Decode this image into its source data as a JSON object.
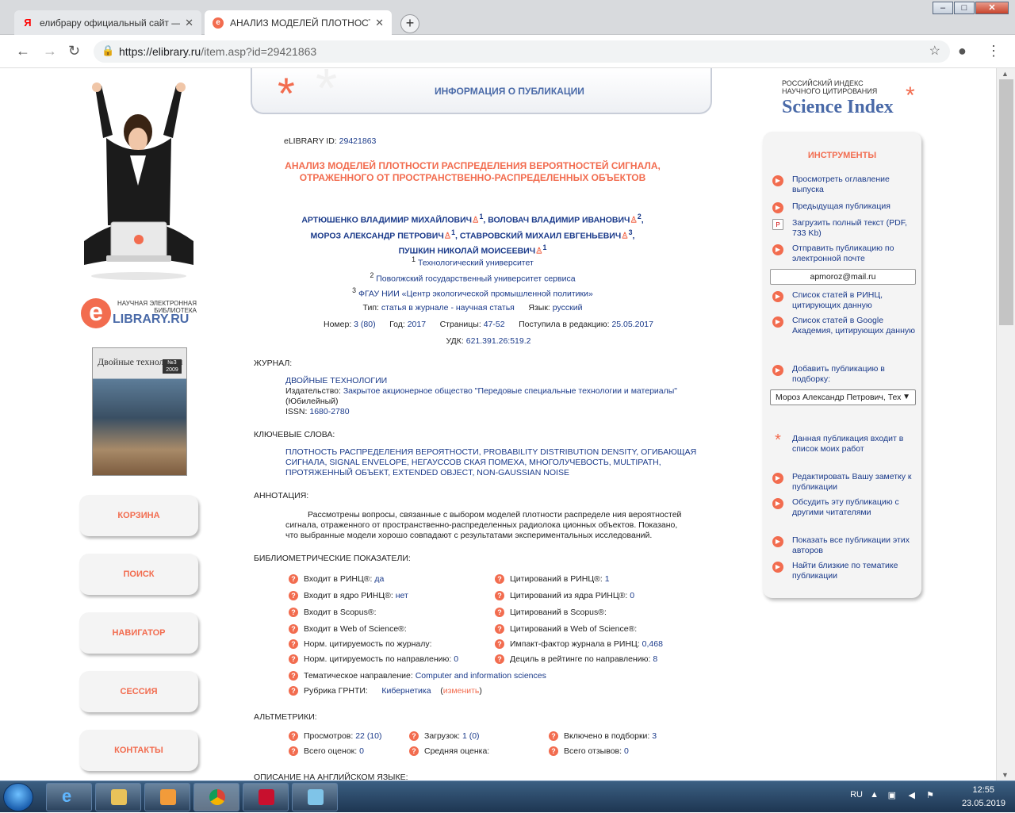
{
  "browser": {
    "tabs": [
      {
        "title": "елибрару официальный сайт — ...",
        "favicon": "yandex-icon",
        "active": false
      },
      {
        "title": "АНАЛИЗ МОДЕЛЕЙ ПЛОТНОСТИ",
        "favicon": "elibrary-icon",
        "active": true
      }
    ],
    "url_host": "https://elibrary.ru",
    "url_path": "/item.asp?id=29421863"
  },
  "left": {
    "logo_line1": "НАУЧНАЯ ЭЛЕКТРОННАЯ",
    "logo_line2": "БИБЛИОТЕКА",
    "logo_main": "LIBRARY.RU",
    "cover_title": "Двойные технологии",
    "cover_issue": "№3 2009",
    "nav": [
      "КОРЗИНА",
      "ПОИСК",
      "НАВИГАТОР",
      "СЕССИЯ",
      "КОНТАКТЫ"
    ]
  },
  "header": {
    "title": "ИНФОРМАЦИЯ О ПУБЛИКАЦИИ"
  },
  "pub": {
    "id_label": "eLIBRARY ID:",
    "id": "29421863",
    "title": "АНАЛИЗ МОДЕЛЕЙ ПЛОТНОСТИ РАСПРЕДЕЛЕНИЯ ВЕРОЯТНОСТЕЙ СИГНАЛА, ОТРАЖЕННОГО ОТ ПРОСТРАНСТВЕННО-РАСПРЕДЕЛЕННЫХ ОБЪЕКТОВ",
    "authors": [
      {
        "name": "АРТЮШЕНКО ВЛАДИМИР МИХАЙЛОВИЧ",
        "sup": "1"
      },
      {
        "name": "ВОЛОВАЧ ВЛАДИМИР ИВАНОВИЧ",
        "sup": "2"
      },
      {
        "name": "МОРОЗ АЛЕКСАНДР ПЕТРОВИЧ",
        "sup": "1"
      },
      {
        "name": "СТАВРОВСКИЙ МИХАИЛ ЕВГЕНЬЕВИЧ",
        "sup": "3"
      },
      {
        "name": "ПУШКИН НИКОЛАЙ МОИСЕЕВИЧ",
        "sup": "1"
      }
    ],
    "affiliations": [
      {
        "n": "1",
        "name": "Технологический университет"
      },
      {
        "n": "2",
        "name": "Поволжский государственный университет сервиса"
      },
      {
        "n": "3",
        "name": "ФГАУ НИИ «Центр экологической промышленной политики»"
      }
    ],
    "type_label": "Тип:",
    "type": "статья в журнале - научная статья",
    "lang_label": "Язык:",
    "lang": "русский",
    "num_label": "Номер:",
    "num": "3 (80)",
    "year_label": "Год:",
    "year": "2017",
    "pages_label": "Страницы:",
    "pages": "47-52",
    "received_label": "Поступила в редакцию:",
    "received": "25.05.2017",
    "udk_label": "УДК:",
    "udk": "621.391.26:519.2"
  },
  "journal": {
    "heading": "ЖУРНАЛ:",
    "name": "ДВОЙНЫЕ ТЕХНОЛОГИИ",
    "publisher_label": "Издательство:",
    "publisher": "Закрытое акционерное общество \"Передовые специальные технологии и материалы\"",
    "jubilee": "(Юбилейный)",
    "issn_label": "ISSN:",
    "issn": "1680-2780"
  },
  "keywords": {
    "heading": "КЛЮЧЕВЫЕ СЛОВА:",
    "line1": "ПЛОТНОСТЬ РАСПРЕДЕЛЕНИЯ ВЕРОЯТНОСТИ, PROBABILITY DISTRIBUTION DENSITY, ОГИБАЮЩАЯ",
    "line2": "СИГНАЛА, SIGNAL ENVELOPE, НЕГАУССОВ СКАЯ ПОМЕХА, МНОГОЛУЧЕВОСТЬ, MULTIPATH,",
    "line3": "ПРОТЯЖЕННЫЙ ОБЪЕКТ, EXTENDED OBJECT, NON-GAUSSIAN NOISE"
  },
  "annotation": {
    "heading": "АННОТАЦИЯ:",
    "line1": "Рассмотрены вопросы, связанные с выбором моделей плотности распределе ния вероятностей",
    "line2": "сигнала, отраженного от пространственно-распределенных радиолока ционных объектов. Показано,",
    "line3": "что выбранные модели хорошо совпадают с результатами экспериментальных исследований."
  },
  "biblio": {
    "heading": "БИБЛИОМЕТРИЧЕСКИЕ ПОКАЗАТЕЛИ:",
    "left": [
      {
        "label": "Входит в РИНЦ®:",
        "value": "да"
      },
      {
        "label": "Входит в ядро РИНЦ®:",
        "value": "нет"
      },
      {
        "label": "Входит в Scopus®:",
        "value": ""
      },
      {
        "label": "Входит в Web of Science®:",
        "value": ""
      },
      {
        "label": "Норм. цитируемость по журналу:",
        "value": ""
      },
      {
        "label": "Норм. цитируемость по направлению:",
        "value": "0"
      }
    ],
    "right": [
      {
        "label": "Цитирований в РИНЦ®:",
        "value": "1"
      },
      {
        "label": "Цитирований из ядра РИНЦ®:",
        "value": "0"
      },
      {
        "label": "Цитирований в Scopus®:",
        "value": ""
      },
      {
        "label": "Цитирований в Web of Science®:",
        "value": ""
      },
      {
        "label": "Импакт-фактор журнала в РИНЦ:",
        "value": "0,468"
      },
      {
        "label": "Дециль в рейтинге по направлению:",
        "value": "8"
      }
    ],
    "topic_label": "Тематическое направление:",
    "topic": "Computer and information sciences",
    "grnti_label": "Рубрика ГРНТИ:",
    "grnti": "Кибернетика",
    "grnti_change": "изменить"
  },
  "altmetrics": {
    "heading": "АЛЬТМЕТРИКИ:",
    "items": [
      {
        "label": "Просмотров:",
        "value": "22 (10)"
      },
      {
        "label": "Загрузок:",
        "value": "1 (0)"
      },
      {
        "label": "Включено в подборки:",
        "value": "3"
      },
      {
        "label": "Всего оценок:",
        "value": "0"
      },
      {
        "label": "Средняя оценка:",
        "value": ""
      },
      {
        "label": "Всего отзывов:",
        "value": "0"
      }
    ]
  },
  "english_heading": "ОПИСАНИЕ НА АНГЛИЙСКОМ ЯЗЫКЕ:",
  "right": {
    "si_line1": "РОССИЙСКИЙ ИНДЕКС",
    "si_line2": "НАУЧНОГО ЦИТИРОВАНИЯ",
    "si_main": "Science Index",
    "tools_heading": "ИНСТРУМЕНТЫ",
    "tools": [
      "Просмотреть оглавление выпуска",
      "Предыдущая публикация",
      "Загрузить полный текст (PDF, 733 Kb)",
      "Отправить публикацию по электронной почте",
      "Список статей в РИНЦ, цитирующих данную",
      "Список статей в Google Академия, цитирующих данную",
      "Добавить публикацию в подборку:",
      "Данная публикация входит в список моих работ",
      "Редактировать Вашу заметку к публикации",
      "Обсудить эту публикацию с другими читателями",
      "Показать все публикации этих авторов",
      "Найти близкие по тематике публикации"
    ],
    "email": "apmoroz@mail.ru",
    "author_select": "Мороз Александр Петрович, Тех"
  },
  "taskbar": {
    "lang": "RU",
    "time": "12:55",
    "date": "23.05.2019"
  },
  "colors": {
    "accent": "#f26c4f",
    "link": "#1a3a8a",
    "heading_blue": "#4a6aa8"
  }
}
